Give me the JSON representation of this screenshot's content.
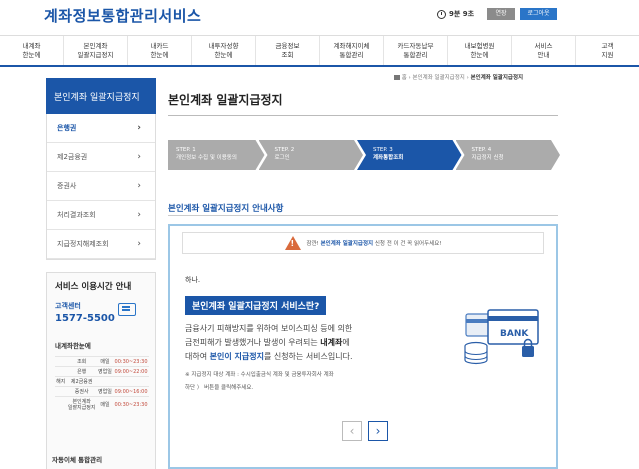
{
  "header": {
    "logo": "계좌정보통합관리서비스",
    "timer": "9분 9초",
    "extend": "연장",
    "logout": "로그아웃"
  },
  "gnb": [
    "내계좌\n한눈에",
    "본인계좌\n일괄지급정지",
    "내카드\n한눈에",
    "내투자성향\n한눈에",
    "금융정보\n조회",
    "계좌해지이체\n통합관리",
    "카드자동납부\n통합관리",
    "내보험병원\n한눈에",
    "서비스\n안내",
    "고객\n지원"
  ],
  "sidebar": {
    "title": "본인계좌 일괄지급정지",
    "items": [
      "은행권",
      "제2금융권",
      "증권사",
      "처리결과조회",
      "지급정지해제조회"
    ],
    "service": {
      "title": "서비스 이용시간 안내",
      "call_label": "고객센터",
      "call_number": "1577-5500",
      "sub_title": "내계좌한눈에",
      "hours": [
        [
          "",
          "조회",
          "매일",
          "00:30~23:30"
        ],
        [
          "",
          "은행",
          "영업일",
          "09:00~22:00"
        ],
        [
          "해지",
          "제2금융권",
          "",
          ""
        ],
        [
          "",
          "증권사",
          "영업일",
          "09:00~16:00"
        ],
        [
          "",
          "본인계좌\n일괄지급정지",
          "매일",
          "00:30~23:30"
        ]
      ],
      "auto_label": "자동이체 통합관리"
    }
  },
  "breadcrumb": {
    "home": "홈",
    "mid": "본인계좌 일괄지급정지",
    "current": "본인계좌 일괄지급정지"
  },
  "page_title": "본인계좌 일괄지급정지",
  "steps": [
    {
      "num": "STEP. 1",
      "label": "개인정보 수집 및 이용동의"
    },
    {
      "num": "STEP. 2",
      "label": "로그인"
    },
    {
      "num": "STEP. 3",
      "label": "계좌통합조회"
    },
    {
      "num": "STEP. 4",
      "label": "지급정지 신청"
    }
  ],
  "section_title": "본인계좌 일괄지급정지 안내사항",
  "notice": {
    "warn_prefix": "잠깐!",
    "warn_highlight": "본인계좌 일괄지급정지",
    "warn_suffix": "신청 전 이 건 꼭 읽어두세요!",
    "hello": "하나.",
    "question": "본인계좌 일괄지급정지 서비스란?",
    "desc_1": "금융사기 피해방지를 위하여 보이스피싱 등에 의한",
    "desc_2a": "금전피해가 발생했거나 발생이 우려되는 ",
    "desc_2b": "내계좌",
    "desc_2c": "에",
    "desc_3a": "대하여 ",
    "desc_3b": "본인이 지급정지",
    "desc_3c": "를 신청하는 서비스입니다.",
    "note_1": "※ 지급정지 대상 계좌 : 수시입출금식 계좌 및 금융투자회사 계좌",
    "note_2": "하단 〉 버튼을 클릭해주세요.",
    "bank_label": "BANK"
  },
  "colors": {
    "primary": "#1b56a8",
    "step_inactive": "#ababab",
    "warning": "#d96a3c",
    "box_border": "#9cc7e6"
  }
}
